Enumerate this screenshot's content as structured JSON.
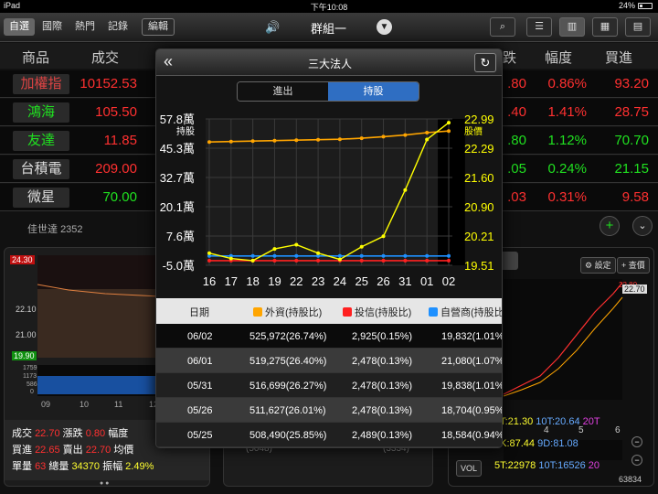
{
  "status": {
    "device": "iPad",
    "time": "下午10:08",
    "battery": "24%"
  },
  "toolbar": {
    "tabs": [
      "自選",
      "國際",
      "熱門",
      "記錄"
    ],
    "edit": "編輯",
    "group": "群組一"
  },
  "list": {
    "headers": {
      "name": "商品",
      "price": "成交",
      "change": "跌",
      "pct": "幅度",
      "bid": "買進"
    },
    "rows": [
      {
        "name": "加權指",
        "price": "10152.53",
        "r1": ".80",
        "r2": "0.86%",
        "r3": "93.20"
      },
      {
        "name": "鴻海",
        "price": "105.50",
        "r1": ".40",
        "r2": "1.41%",
        "r3": "28.75"
      },
      {
        "name": "友達",
        "price": "11.85",
        "r1": ".80",
        "r2": "1.12%",
        "r3": "70.70"
      },
      {
        "name": "台積電",
        "price": "209.00",
        "r1": ".05",
        "r2": "0.24%",
        "r3": "21.15"
      },
      {
        "name": "微星",
        "price": "70.00",
        "r1": ".03",
        "r2": "0.31%",
        "r3": "9.58"
      }
    ],
    "sub": {
      "name": "佳世達",
      "code": "2352"
    }
  },
  "left_panel": {
    "price_tags": [
      "24.30",
      "22.10",
      "21.00",
      "19.90"
    ],
    "vol_ticks": [
      "1759",
      "1173",
      "586",
      "0"
    ],
    "time_ticks": [
      "09",
      "10",
      "11",
      "12",
      "13"
    ],
    "stats": [
      {
        "l1": "成交",
        "v1": "22.70",
        "l2": "漲跌",
        "v2": "0.80",
        "l3": "幅度"
      },
      {
        "l1": "買進",
        "v1": "22.65",
        "l2": "賣出",
        "v2": "22.70",
        "l3": "均價"
      },
      {
        "l1": "單量",
        "v1": "63",
        "l2": "總量",
        "v2": "34370",
        "l3": "振幅",
        "v3": "2.49%"
      }
    ],
    "mid_hint": [
      "(5048)",
      "(3334)"
    ]
  },
  "kline": {
    "settings": "設定",
    "query": "查價",
    "price_top": "22.70",
    "price_top_red": "22.80",
    "ma_line1": "5T:21.30",
    "ma_line1b": "10T:20.64",
    "ma_line1c": "20T",
    "kd_line": "5K:87.44",
    "kd_line_b": "9D:81.08",
    "vol_btn": "VOL",
    "vol_line": "5T:22978",
    "vol_line_b": "10T:16526",
    "vol_line_c": "20",
    "vol_last": "63834",
    "x_ticks": [
      "4",
      "5",
      "6"
    ]
  },
  "modal": {
    "title": "三大法人",
    "seg_in_out": "進出",
    "seg_hold": "持股",
    "left_axis_label": "持股",
    "right_axis_label": "股價",
    "table": {
      "headers": {
        "date": "日期",
        "foreign": "外資(持股比)",
        "trust": "投信(持股比)",
        "dealer": "自營商(持股比)"
      },
      "rows": [
        {
          "date": "06/02",
          "foreign": "525,972(26.74%)",
          "trust": "2,925(0.15%)",
          "dealer": "19,832(1.01%)"
        },
        {
          "date": "06/01",
          "foreign": "519,275(26.40%)",
          "trust": "2,478(0.13%)",
          "dealer": "21,080(1.07%)"
        },
        {
          "date": "05/31",
          "foreign": "516,699(26.27%)",
          "trust": "2,478(0.13%)",
          "dealer": "19,838(1.01%)"
        },
        {
          "date": "05/26",
          "foreign": "511,627(26.01%)",
          "trust": "2,478(0.13%)",
          "dealer": "18,704(0.95%)"
        },
        {
          "date": "05/25",
          "foreign": "508,490(25.85%)",
          "trust": "2,489(0.13%)",
          "dealer": "18,584(0.94%)"
        }
      ]
    }
  },
  "colors": {
    "foreign": "#ffa500",
    "trust": "#ff2020",
    "dealer": "#1e90ff",
    "price": "#ffff00"
  },
  "chart_data": {
    "type": "line",
    "title": "三大法人",
    "x": [
      "16",
      "17",
      "18",
      "19",
      "22",
      "23",
      "24",
      "25",
      "26",
      "31",
      "01",
      "02"
    ],
    "left_axis": {
      "label": "持股",
      "ticks": [
        "57.8萬",
        "45.3萬",
        "32.7萬",
        "20.1萬",
        "7.6萬",
        "-5.0萬"
      ],
      "range": [
        -5.0,
        57.8
      ],
      "unit": "萬"
    },
    "right_axis": {
      "label": "股價",
      "ticks": [
        "22.99",
        "22.29",
        "21.60",
        "20.90",
        "20.21",
        "19.51"
      ],
      "range": [
        19.51,
        22.99
      ]
    },
    "series": [
      {
        "axis": "left",
        "color": "#ffa500",
        "values": [
          47.9,
          48.1,
          48.3,
          48.5,
          48.7,
          48.9,
          49.1,
          49.5,
          50.2,
          50.9,
          51.9,
          52.6
        ]
      },
      {
        "axis": "left",
        "color": "#ff2020",
        "values": [
          -3.0,
          -3.0,
          -3.0,
          -3.0,
          -3.0,
          -3.0,
          -3.0,
          -3.0,
          -3.0,
          -3.0,
          -3.0,
          -3.0
        ]
      },
      {
        "axis": "left",
        "color": "#1e90ff",
        "values": [
          -1.0,
          -1.0,
          -1.0,
          -1.0,
          -1.0,
          -1.0,
          -1.0,
          -1.0,
          -1.0,
          -1.0,
          -1.0,
          -1.0
        ]
      },
      {
        "axis": "right",
        "color": "#ffff00",
        "values": [
          19.8,
          19.67,
          19.62,
          19.9,
          20.0,
          19.8,
          19.65,
          19.95,
          20.2,
          21.3,
          22.5,
          22.9
        ]
      }
    ],
    "highlight_index": 11,
    "grid": true
  }
}
